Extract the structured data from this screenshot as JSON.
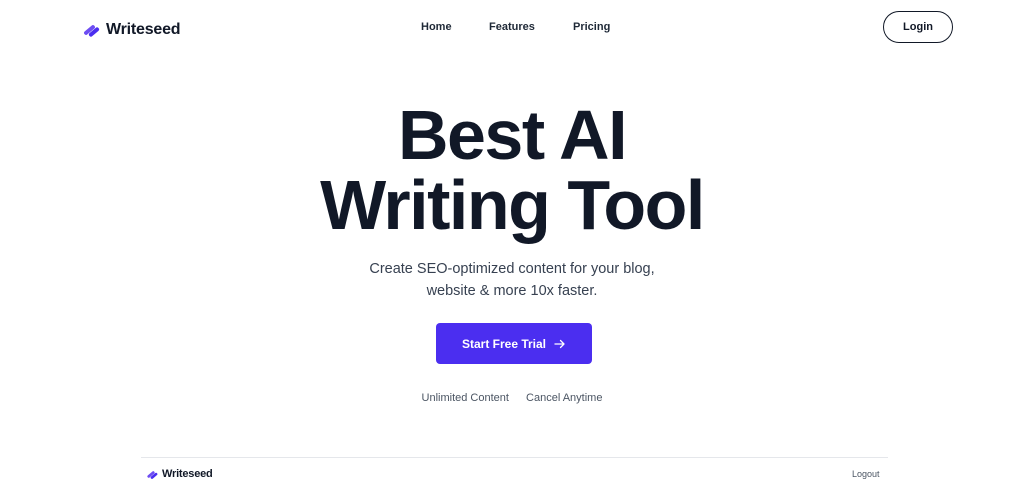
{
  "brand": {
    "name": "Writeseed",
    "accent_color": "#4b2ef0",
    "logo_icon": "writeseed-logo-icon"
  },
  "nav": {
    "links": [
      {
        "label": "Home"
      },
      {
        "label": "Features"
      },
      {
        "label": "Pricing"
      }
    ],
    "login_label": "Login"
  },
  "hero": {
    "title_line1": "Best AI",
    "title_line2": "Writing Tool",
    "subtitle_line1": "Create SEO-optimized content for your blog,",
    "subtitle_line2": "website & more 10x faster.",
    "cta_label": "Start Free Trial",
    "cta_icon": "arrow-right-icon",
    "features": [
      "Unlimited Content",
      "Cancel Anytime"
    ]
  },
  "footer": {
    "brand_name": "Writeseed",
    "logout_label": "Logout"
  }
}
